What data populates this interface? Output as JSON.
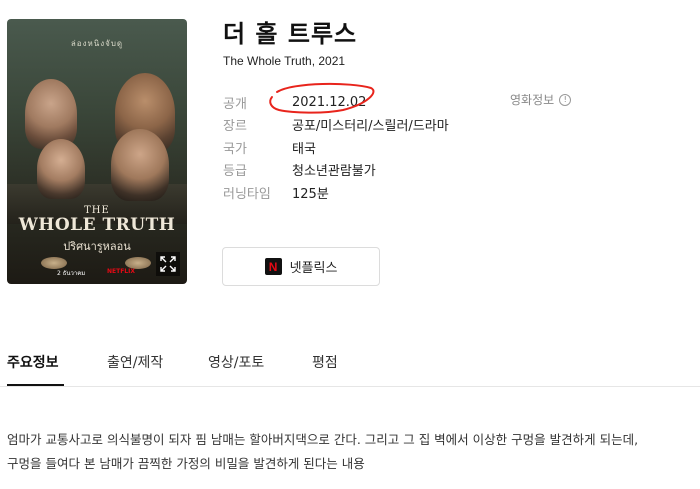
{
  "movie": {
    "title": "더 홀 트루스",
    "subtitle": "The Whole Truth, 2021"
  },
  "poster": {
    "top_text": "ล่องหนิงจับดู",
    "title_line1": "THE",
    "title_line2": "WHOLE TRUTH",
    "title_thai": "ปริศนารูหลอน",
    "release_text": "2 ธันวาคม",
    "brand": "NETFLIX"
  },
  "info": [
    {
      "label": "공개",
      "value": "2021.12.02"
    },
    {
      "label": "장르",
      "value": "공포/미스터리/스릴러/드라마"
    },
    {
      "label": "국가",
      "value": "태국"
    },
    {
      "label": "등급",
      "value": "청소년관람불가"
    },
    {
      "label": "러닝타임",
      "value": "125분"
    }
  ],
  "movie_info_link": "영화정보",
  "watch_button": {
    "label": "넷플릭스",
    "logo_letter": "N"
  },
  "tabs": [
    {
      "label": "주요정보"
    },
    {
      "label": "출연/제작"
    },
    {
      "label": "영상/포토"
    },
    {
      "label": "평점"
    }
  ],
  "plot": {
    "line1": "엄마가 교통사고로 의식불명이 되자 핌 남매는 할아버지댁으로 간다. 그리고 그 집 벽에서 이상한 구멍을 발견하게 되는데,",
    "line2": "구멍을 들여다 본 남매가 끔찍한 가정의 비밀을 발견하게 된다는 내용"
  },
  "colors": {
    "annotation": "#e8241c",
    "netflix_red": "#e50914",
    "active_tab": "#111111"
  }
}
